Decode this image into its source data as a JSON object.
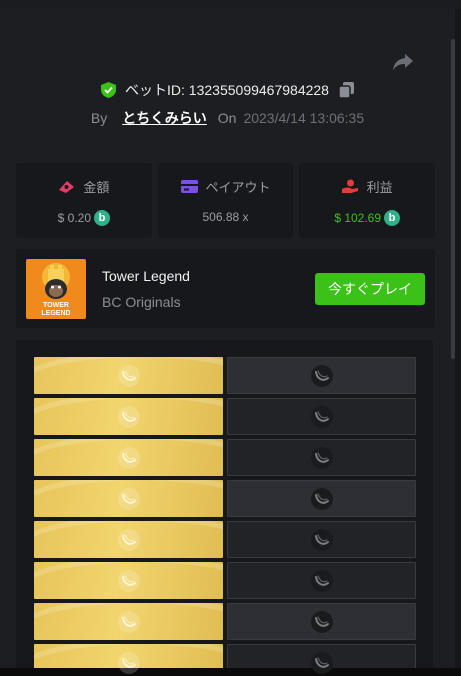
{
  "bet": {
    "id_label": "ベットID: 132355099467984228",
    "by_label": "By",
    "username": "とちくみらい",
    "on_label": "On",
    "datetime": "2023/4/14 13:06:35"
  },
  "stats": {
    "amount": {
      "label": "金額",
      "value": "$ 0.20",
      "icon": "money-icon"
    },
    "payout": {
      "label": "ペイアウト",
      "value": "506.88 x",
      "icon": "card-icon"
    },
    "profit": {
      "label": "利益",
      "value": "$ 102.69",
      "icon": "hand-coin-icon"
    }
  },
  "game": {
    "title": "Tower Legend",
    "provider": "BC Originals",
    "thumb_text": "TOWER LEGEND",
    "play_label": "今すぐプレイ"
  },
  "coin_symbol": "b",
  "colors": {
    "accent_green": "#3bc117",
    "gold_tile": "#ecca60",
    "dark_tile": "#2e2f34",
    "coin": "#2eb08a"
  },
  "board": {
    "rows": [
      [
        "gold",
        "dark"
      ],
      [
        "gold",
        "dim"
      ],
      [
        "gold",
        "dim"
      ],
      [
        "gold",
        "dark"
      ],
      [
        "gold",
        "dim"
      ],
      [
        "gold",
        "dim"
      ],
      [
        "gold",
        "dark"
      ],
      [
        "gold",
        "dim"
      ]
    ]
  }
}
